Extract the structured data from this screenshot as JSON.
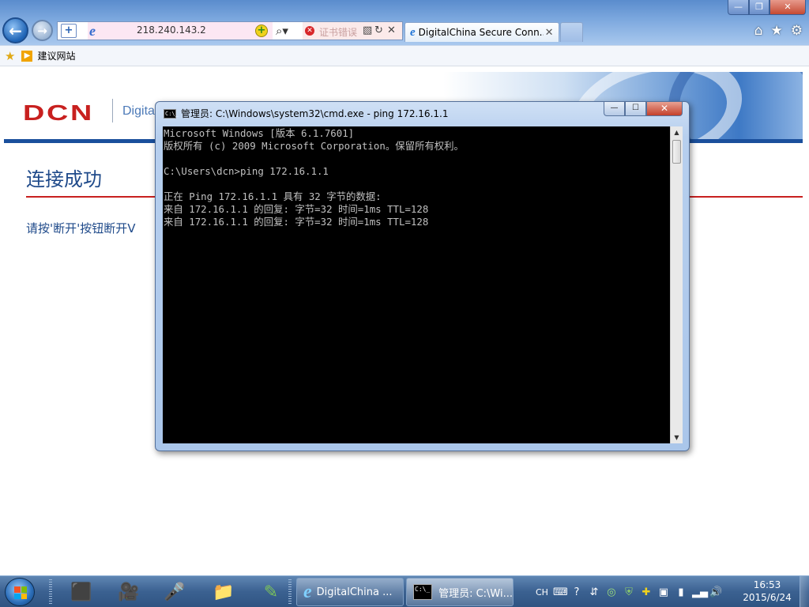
{
  "browser": {
    "address_url": "218.240.143.2",
    "cert_error_label": "证书错误",
    "tab_title": "DigitalChina Secure Conn...",
    "tab_close": "✕",
    "favorites_item": "建议网站",
    "window_minimize": "—",
    "window_restore": "❐",
    "window_close": "✕"
  },
  "page": {
    "logo": "DCN",
    "brand_text": "Digita",
    "title": "连接成功",
    "message": "请按'断开'按钮断开V"
  },
  "cmd_window": {
    "title": "管理员: C:\\Windows\\system32\\cmd.exe - ping  172.16.1.1",
    "icon_text": "C:\\_",
    "lines": [
      "Microsoft Windows [版本 6.1.7601]",
      "版权所有 (c) 2009 Microsoft Corporation。保留所有权利。",
      "",
      "C:\\Users\\dcn>ping 172.16.1.1",
      "",
      "正在 Ping 172.16.1.1 具有 32 字节的数据:",
      "来自 172.16.1.1 的回复: 字节=32 时间=1ms TTL=128",
      "来自 172.16.1.1 的回复: 字节=32 时间=1ms TTL=128"
    ]
  },
  "taskbar": {
    "ie_button_label": "DigitalChina ...",
    "cmd_button_label": "管理员: C:\\Wi...",
    "cmd_button_icon_text": "C:\\_",
    "language": "CH",
    "time": "16:53",
    "date": "2015/6/24"
  },
  "colors": {
    "dcn_red": "#c8201f",
    "page_blue": "#1f4a8a",
    "console_bg": "#000000",
    "console_text": "#c0c0c0"
  }
}
